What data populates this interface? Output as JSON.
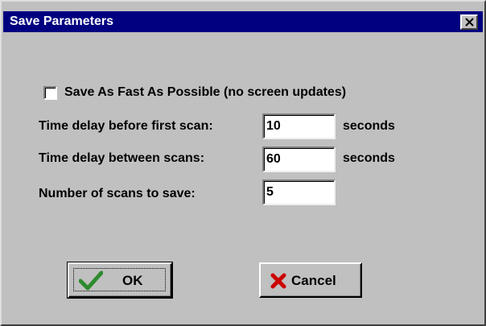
{
  "window": {
    "title": "Save Parameters",
    "close_label": "close"
  },
  "options": {
    "fast_save": {
      "label": "Save As Fast As Possible (no screen updates)",
      "checked": false
    }
  },
  "fields": {
    "first_scan": {
      "label": "Time delay before first scan:",
      "value": "10",
      "unit": "seconds"
    },
    "between_scans": {
      "label": "Time delay between scans:",
      "value": "60",
      "unit": "seconds"
    },
    "num_scans": {
      "label": "Number of scans to save:",
      "value": "5"
    }
  },
  "buttons": {
    "ok": {
      "label": "OK",
      "icon": "checkmark-icon"
    },
    "cancel": {
      "label": "Cancel",
      "icon": "x-mark-icon"
    }
  },
  "colors": {
    "titlebar": "#000080",
    "face": "#c0c0c0",
    "ok_icon": "#2e8b2e",
    "cancel_icon": "#cc0000"
  }
}
